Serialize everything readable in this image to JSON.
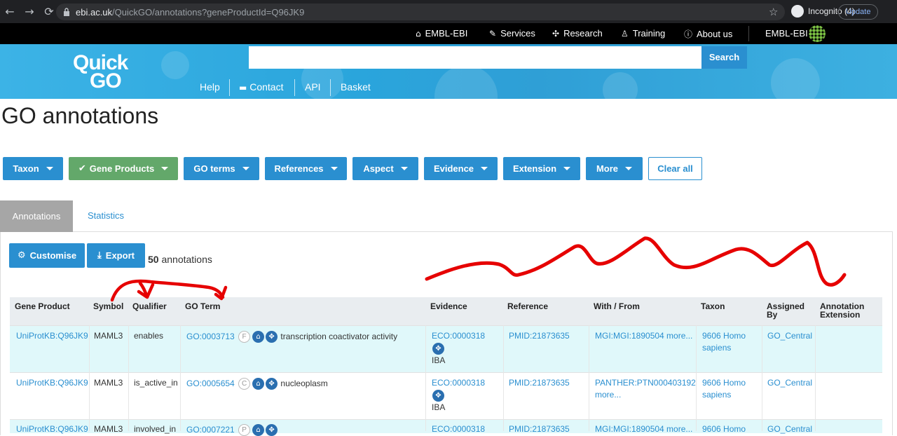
{
  "browser": {
    "url_host": "ebi.ac.uk",
    "url_path": "/QuickGO/annotations?geneProductId=Q96JK9",
    "profile": "Incognito (4)",
    "update_label": "Update"
  },
  "ebi_bar": {
    "links": [
      "EMBL-EBI",
      "Services",
      "Research",
      "Training",
      "About us"
    ],
    "right_label": "EMBL-EBI"
  },
  "header": {
    "logo_top": "Quick",
    "logo_bottom": "GO",
    "search_placeholder": "",
    "search_label": "Search",
    "nav": [
      "Help",
      "Contact",
      "API",
      "Basket"
    ]
  },
  "page_title": "GO annotations",
  "filters": {
    "taxon": "Taxon",
    "gene_products": "Gene Products",
    "go_terms": "GO terms",
    "references": "References",
    "aspect": "Aspect",
    "evidence": "Evidence",
    "extension": "Extension",
    "more": "More",
    "clear_all": "Clear all"
  },
  "tabs": {
    "annotations": "Annotations",
    "statistics": "Statistics"
  },
  "actions": {
    "customise": "Customise",
    "export": "Export",
    "count": "50",
    "count_label": "annotations"
  },
  "table": {
    "headers": {
      "gene_product": "Gene Product",
      "symbol": "Symbol",
      "qualifier": "Qualifier",
      "go_term": "GO Term",
      "evidence": "Evidence",
      "reference": "Reference",
      "with_from": "With / From",
      "taxon": "Taxon",
      "assigned_by_1": "Assigned",
      "assigned_by_2": "By",
      "annotation_extension_1": "Annotation",
      "annotation_extension_2": "Extension"
    },
    "rows": [
      {
        "gene_product": "UniProtKB:Q96JK9",
        "symbol": "MAML3",
        "qualifier": "enables",
        "go_id": "GO:0003713",
        "aspect": "F",
        "go_name": "transcription coactivator activity",
        "evidence": "ECO:0000318",
        "evidence_code": "IBA",
        "reference": "PMID:21873635",
        "with_from_1": "MGI:MGI:1890504 more...",
        "with_from_2": "",
        "taxon_1": "9606 Homo",
        "taxon_2": "sapiens",
        "assigned_by": "GO_Central"
      },
      {
        "gene_product": "UniProtKB:Q96JK9",
        "symbol": "MAML3",
        "qualifier": "is_active_in",
        "go_id": "GO:0005654",
        "aspect": "C",
        "go_name": "nucleoplasm",
        "evidence": "ECO:0000318",
        "evidence_code": "IBA",
        "reference": "PMID:21873635",
        "with_from_1": "PANTHER:PTN000403192",
        "with_from_2": "more...",
        "taxon_1": "9606 Homo",
        "taxon_2": "sapiens",
        "assigned_by": "GO_Central"
      },
      {
        "gene_product": "UniProtKB:Q96JK9",
        "symbol": "MAML3",
        "qualifier": "involved_in",
        "go_id": "GO:0007221",
        "aspect": "P",
        "go_name": "",
        "evidence": "ECO:0000318",
        "evidence_code": "",
        "reference": "PMID:21873635",
        "with_from_1": "MGI:MGI:1890504 more...",
        "with_from_2": "",
        "taxon_1": "9606 Homo",
        "taxon_2": "",
        "assigned_by": "GO_Central"
      }
    ]
  },
  "colors": {
    "accent": "#2a8fd0",
    "green": "#63a86a",
    "row_highlight": "#e0f8fa",
    "scribble": "#e60000"
  }
}
